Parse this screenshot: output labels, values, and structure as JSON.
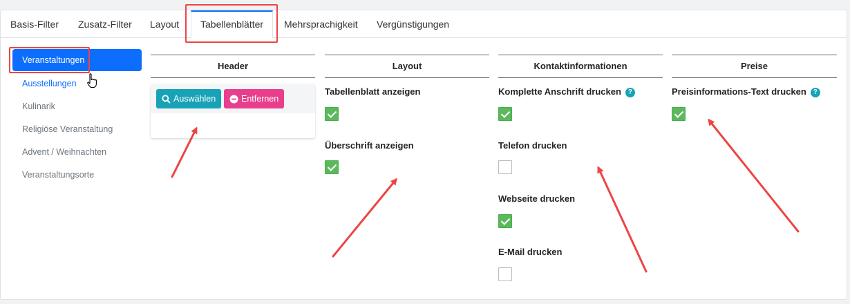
{
  "tabs": [
    {
      "label": "Basis-Filter",
      "active": false
    },
    {
      "label": "Zusatz-Filter",
      "active": false
    },
    {
      "label": "Layout",
      "active": false
    },
    {
      "label": "Tabellenblätter",
      "active": true
    },
    {
      "label": "Mehrsprachigkeit",
      "active": false
    },
    {
      "label": "Vergünstigungen",
      "active": false
    }
  ],
  "sidebar": {
    "items": [
      {
        "label": "Veranstaltungen",
        "state": "active"
      },
      {
        "label": "Ausstellungen",
        "state": "link"
      },
      {
        "label": "Kulinarik",
        "state": "normal"
      },
      {
        "label": "Religiöse Veranstaltung",
        "state": "normal"
      },
      {
        "label": "Advent / Weihnachten",
        "state": "normal"
      },
      {
        "label": "Veranstaltungsorte",
        "state": "normal"
      }
    ]
  },
  "columns": {
    "header": {
      "title": "Header",
      "select_label": "Auswählen",
      "remove_label": "Entfernen"
    },
    "layout": {
      "title": "Layout",
      "options": [
        {
          "label": "Tabellenblatt anzeigen",
          "checked": true
        },
        {
          "label": "Überschrift anzeigen",
          "checked": true
        }
      ]
    },
    "contact": {
      "title": "Kontaktinformationen",
      "options": [
        {
          "label": "Komplette Anschrift drucken",
          "checked": true,
          "help": "?"
        },
        {
          "label": "Telefon drucken",
          "checked": false
        },
        {
          "label": "Webseite drucken",
          "checked": true
        },
        {
          "label": "E-Mail drucken",
          "checked": false
        }
      ]
    },
    "prices": {
      "title": "Preise",
      "options": [
        {
          "label": "Preisinformations-Text drucken",
          "checked": true,
          "help": "?"
        }
      ]
    }
  },
  "colors": {
    "accent": "#0d6efd",
    "annotation": "#ee4444",
    "checkbox_checked": "#5cb85c",
    "select_button": "#17a2b8",
    "remove_button": "#e83e8c"
  }
}
